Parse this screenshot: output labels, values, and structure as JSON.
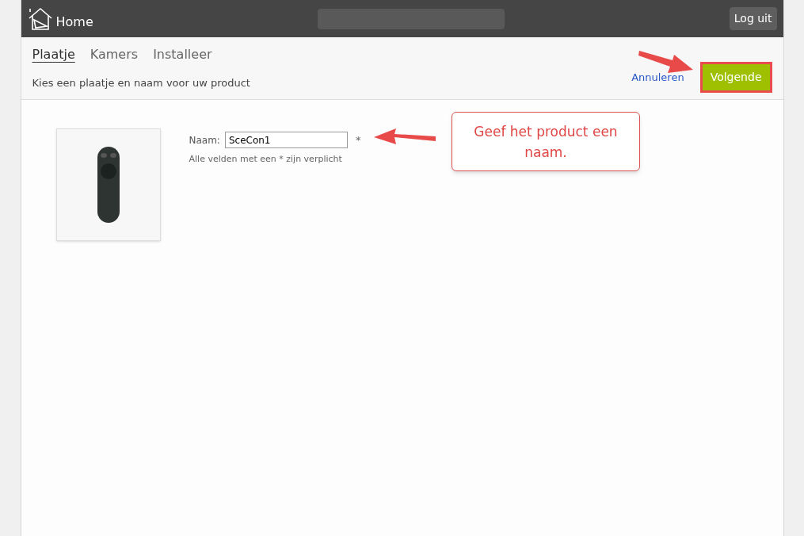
{
  "header": {
    "title": "Home",
    "logout": "Log uit"
  },
  "tabs": [
    {
      "label": "Plaatje",
      "selected": true
    },
    {
      "label": "Kamers",
      "selected": false
    },
    {
      "label": "Installeer",
      "selected": false
    }
  ],
  "subtitle": "Kies een plaatje en naam voor uw product",
  "actions": {
    "cancel": "Annuleren",
    "next": "Volgende"
  },
  "form": {
    "label": "Naam:",
    "value": "SceCon1",
    "required_mark": "*",
    "note": "Alle velden met een * zijn verplicht"
  },
  "callout": {
    "text": "Geef het product een naam."
  }
}
